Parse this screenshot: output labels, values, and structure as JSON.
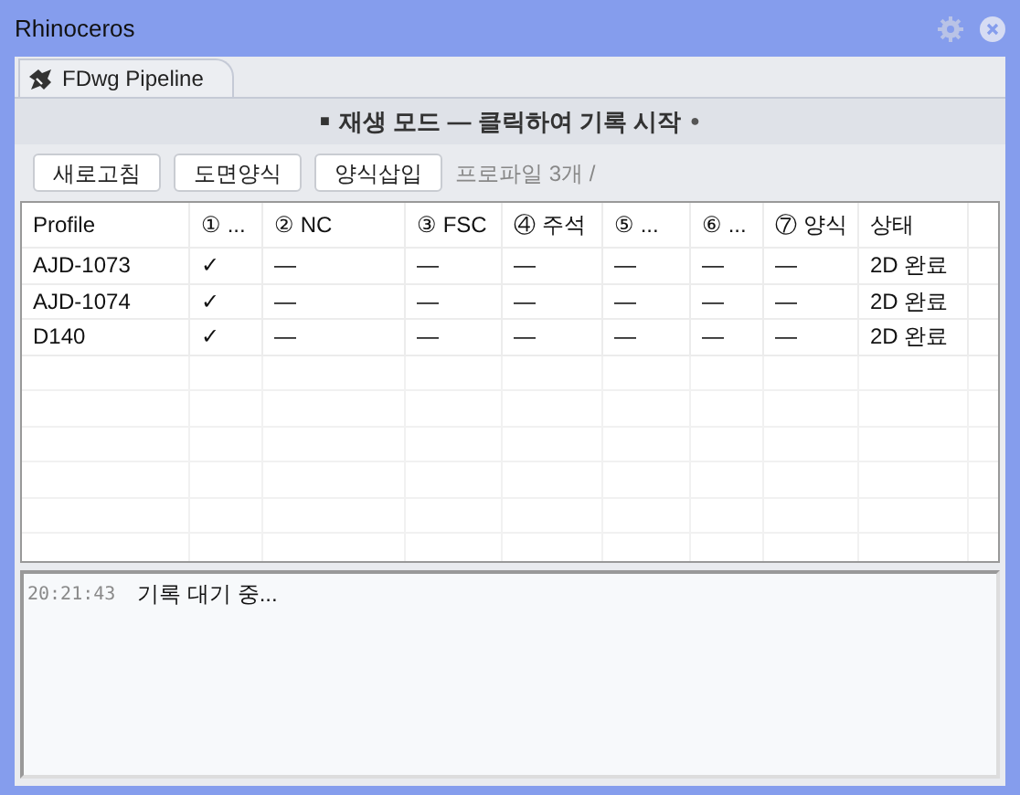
{
  "window": {
    "title": "Rhinoceros"
  },
  "tab": {
    "label": "FDwg Pipeline",
    "selected": true
  },
  "mode_banner": {
    "marker": "■",
    "text": "재생 모드 — 클릭하여 기록 시작",
    "dot": "●"
  },
  "toolbar": {
    "buttons": [
      "새로고침",
      "도면양식",
      "양식삽입"
    ],
    "status": "프로파일 3개 /"
  },
  "table": {
    "columns": [
      "Profile",
      "① ...",
      "② NC",
      "③ FSC",
      "④ 주석",
      "⑤ ...",
      "⑥ ...",
      "⑦ 양식",
      "상태"
    ],
    "rows": [
      {
        "cells": [
          "AJD-1073",
          "✓",
          "—",
          "—",
          "—",
          "—",
          "—",
          "—",
          "2D 완료"
        ]
      },
      {
        "cells": [
          "AJD-1074",
          "✓",
          "—",
          "—",
          "—",
          "—",
          "—",
          "—",
          "2D 완료"
        ]
      },
      {
        "cells": [
          "D140",
          "✓",
          "—",
          "—",
          "—",
          "—",
          "—",
          "—",
          "2D 완료"
        ]
      }
    ]
  },
  "log": [
    {
      "time": "20:21:43",
      "message": "기록 대기 중..."
    }
  ]
}
